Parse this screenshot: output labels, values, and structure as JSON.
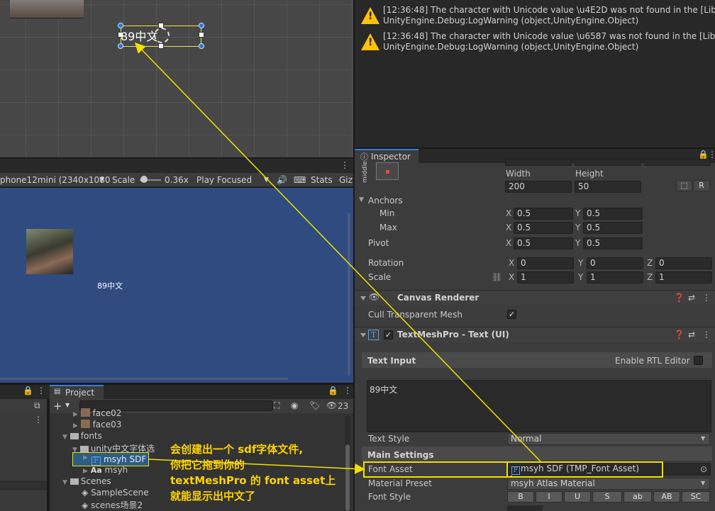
{
  "scene": {
    "text": "89中文"
  },
  "console": {
    "logs": [
      {
        "line1": "[12:36:48] The character with Unicode value \\u4E2D was not found in the [Liberatio",
        "line2": "UnityEngine.Debug:LogWarning (object,UnityEngine.Object)"
      },
      {
        "line1": "[12:36:48] The character with Unicode value \\u6587 was not found in the [Liberatio",
        "line2": "UnityEngine.Debug:LogWarning (object,UnityEngine.Object)"
      }
    ]
  },
  "game": {
    "resolution": "phone12mini (2340x1080",
    "scale_label": "Scale",
    "scale_value": "0.36x",
    "play_mode": "Play Focused",
    "stats": "Stats",
    "gizmos": "Giz",
    "text": "89中文"
  },
  "project": {
    "tab": "Project",
    "badge": "23",
    "tree": {
      "face02": "face02",
      "face03": "face03",
      "fonts": "fonts",
      "unity_folder": "unity中文字体选",
      "msyh_sdf": "msyh SDF",
      "msyh": "msyh",
      "scenes": "Scenes",
      "sample_scene": "SampleScene",
      "scenes2": "scenes场景2"
    }
  },
  "annotation": {
    "line1": "会创建出一个 sdf字体文件,",
    "line2": "你把它拖到你的",
    "line3": "textMeshPro 的 font asset上",
    "line4": "就能显示出中文了"
  },
  "inspector": {
    "tab": "Inspector",
    "middle": "middle",
    "width_label": "Width",
    "height_label": "Height",
    "width": "200",
    "height": "50",
    "r_button": "R",
    "anchors": "Anchors",
    "min": "Min",
    "max": "Max",
    "pivot": "Pivot",
    "rotation": "Rotation",
    "scale": "Scale",
    "axis_x": "X",
    "axis_y": "Y",
    "axis_z": "Z",
    "min_x": "0.5",
    "min_y": "0.5",
    "max_x": "0.5",
    "max_y": "0.5",
    "pivot_x": "0.5",
    "pivot_y": "0.5",
    "rot_x": "0",
    "rot_y": "0",
    "rot_z": "0",
    "scale_x": "1",
    "scale_y": "1",
    "scale_z": "1",
    "canvas_renderer": "Canvas Renderer",
    "cull_transparent": "Cull Transparent Mesh",
    "tmp_title": "TextMeshPro - Text (UI)",
    "text_input": "Text Input",
    "enable_rtl": "Enable RTL Editor",
    "text_value": "89中文",
    "text_style_label": "Text Style",
    "text_style_value": "Normal",
    "main_settings": "Main Settings",
    "font_asset_label": "Font Asset",
    "font_asset_value": "msyh SDF (TMP_Font Asset)",
    "material_preset_label": "Material Preset",
    "material_preset_value": "msyh Atlas Material",
    "font_style_label": "Font Style",
    "style_buttons": [
      "B",
      "I",
      "U",
      "S",
      "ab",
      "AB",
      "SC"
    ]
  }
}
